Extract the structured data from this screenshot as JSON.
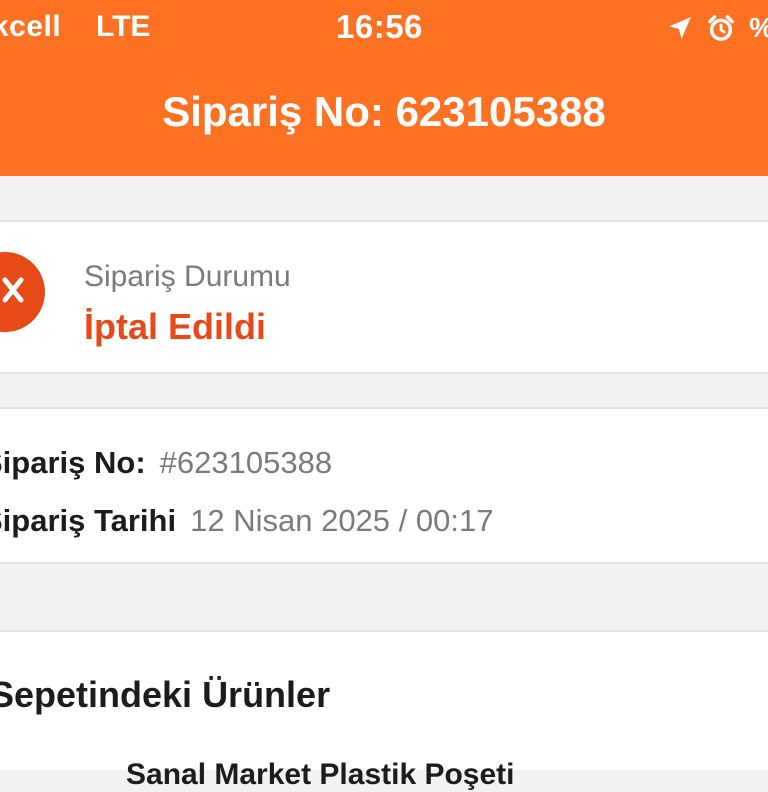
{
  "status_bar": {
    "carrier": "kcell",
    "network": "LTE",
    "time": "16:56",
    "battery_text": "%"
  },
  "nav": {
    "title": "Sipariş No: 623105388"
  },
  "order_status": {
    "label": "Sipariş Durumu",
    "value": "İptal Edildi",
    "icon": "cancel-icon",
    "color": "#e64a19"
  },
  "order_info": {
    "order_no_label": "Sipariş No:",
    "order_no_value": "#623105388",
    "order_date_label": "Sipariş Tarihi",
    "order_date_value": "12 Nisan 2025 / 00:17"
  },
  "basket": {
    "title": "Sepetindeki Ürünler",
    "first_item": "Sanal Market Plastik Poşeti"
  },
  "colors": {
    "brand_orange": "#fd7122",
    "cancel_red": "#e64a19",
    "muted_text": "#7a7a80"
  }
}
